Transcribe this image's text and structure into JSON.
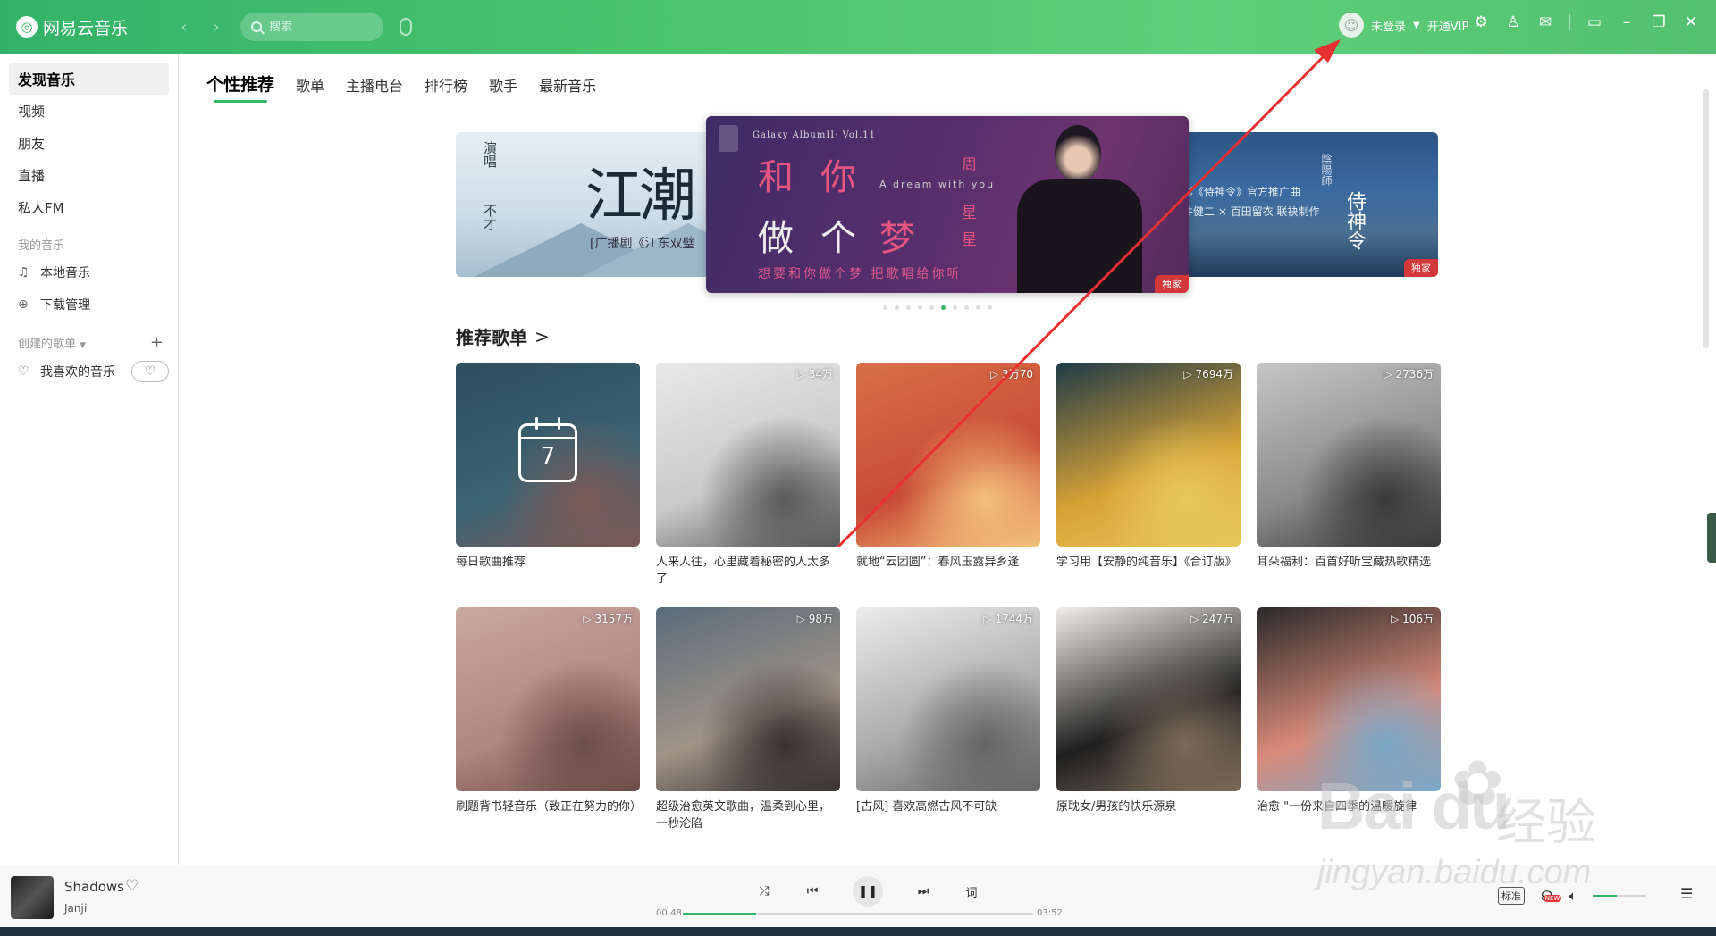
{
  "app": {
    "logo_glyph": "◎",
    "name": "网易云音乐"
  },
  "titlebar": {
    "search_placeholder": "搜索",
    "login_label": "未登录",
    "vip_label": "开通VIP",
    "icons": [
      "gear-icon",
      "skin-icon",
      "mail-icon",
      "mini-mode-icon",
      "minimize-icon",
      "maximize-icon",
      "close-icon"
    ]
  },
  "sidebar": {
    "top_items": [
      "发现音乐",
      "视频",
      "朋友",
      "直播",
      "私人FM"
    ],
    "my_music_header": "我的音乐",
    "my_music_items": [
      {
        "icon": "music-note-icon",
        "glyph": "♫",
        "label": "本地音乐"
      },
      {
        "icon": "download-icon",
        "glyph": "⊕",
        "label": "下载管理"
      }
    ],
    "created_header": "创建的歌单",
    "add_glyph": "+",
    "liked_label": "我喜欢的音乐"
  },
  "tabs": [
    "个性推荐",
    "歌单",
    "主播电台",
    "排行榜",
    "歌手",
    "最新音乐"
  ],
  "banner": {
    "left": {
      "title": "江潮",
      "vert1": "演唱",
      "vert2": "不才",
      "subtitle": "[广播剧《江东双璧"
    },
    "center": {
      "album": "Galaxy AlbumII· Vol.11",
      "line1a": "和",
      "line1b": "你",
      "line2a": "做",
      "line2b": "个",
      "line2c": "梦",
      "english": "A dream with you",
      "star1": "周",
      "star2": "星",
      "star3": "星",
      "subtitle": "想要和你做个梦  把歌唱给你听",
      "badge": "独家"
    },
    "right": {
      "line1": "电影《侍神令》官方推广曲",
      "line2": "王井健二 × 百田留衣 联袂制作",
      "vert_title": "侍神令",
      "vert_small": "陰陽師",
      "badge": "独家"
    },
    "dot_count": 10,
    "active_dot": 5
  },
  "section": {
    "title": "推荐歌单",
    "chevron": ">"
  },
  "playlists": [
    {
      "title": "每日歌曲推荐",
      "count": "",
      "calendar_day": "7",
      "colors": [
        "#2e4d5e",
        "#3b6474",
        "#7a5a56"
      ]
    },
    {
      "title": "人来人往，心里藏着秘密的人太多了",
      "count": "34万",
      "colors": [
        "#e9e9e9",
        "#c9c9c9",
        "#5a5a5a"
      ]
    },
    {
      "title": "就地“云团圆”：春风玉露异乡逢",
      "count": "3万70",
      "colors": [
        "#d9704a",
        "#c94b35",
        "#f3c07b"
      ]
    },
    {
      "title": "学习用【安静的纯音乐】《合订版》",
      "count": "7694万",
      "colors": [
        "#1f3b48",
        "#d8a236",
        "#e9c75a"
      ]
    },
    {
      "title": "耳朵福利：百首好听宝藏热歌精选",
      "count": "2736万",
      "colors": [
        "#c6c6c6",
        "#8a8a8a",
        "#3a3a3a"
      ]
    },
    {
      "title": "刷题背书轻音乐（致正在努力的你）",
      "count": "3157万",
      "colors": [
        "#caa8a2",
        "#b08582",
        "#6d4d4a"
      ]
    },
    {
      "title": "超级治愈英文歌曲，温柔到心里，一秒沦陷",
      "count": "98万",
      "colors": [
        "#5b6c7a",
        "#a09488",
        "#3a3230"
      ]
    },
    {
      "title": "[古风] 喜欢高燃古风不可缺",
      "count": "1744万",
      "colors": [
        "#ececec",
        "#a9a9a9",
        "#666666"
      ]
    },
    {
      "title": "原耽女/男孩的快乐源泉",
      "count": "247万",
      "colors": [
        "#f1eee9",
        "#1f1f1f",
        "#7a6a5a"
      ]
    },
    {
      "title": "治愈 \"一份来自四季的温暖旋律",
      "count": "106万",
      "colors": [
        "#2a2a2a",
        "#d98a7a",
        "#7aa8c8"
      ]
    }
  ],
  "player": {
    "title": "Shadows",
    "artist": "Janji",
    "elapsed": "00:48",
    "duration": "03:52",
    "progress": 0.21,
    "lyrics_label": "词",
    "quality_label": "标准",
    "new_tag": "NEW",
    "volume": 0.45
  },
  "watermark": {
    "brand": "Bai du",
    "cn": "经验",
    "url": "jingyan.baidu.com"
  }
}
